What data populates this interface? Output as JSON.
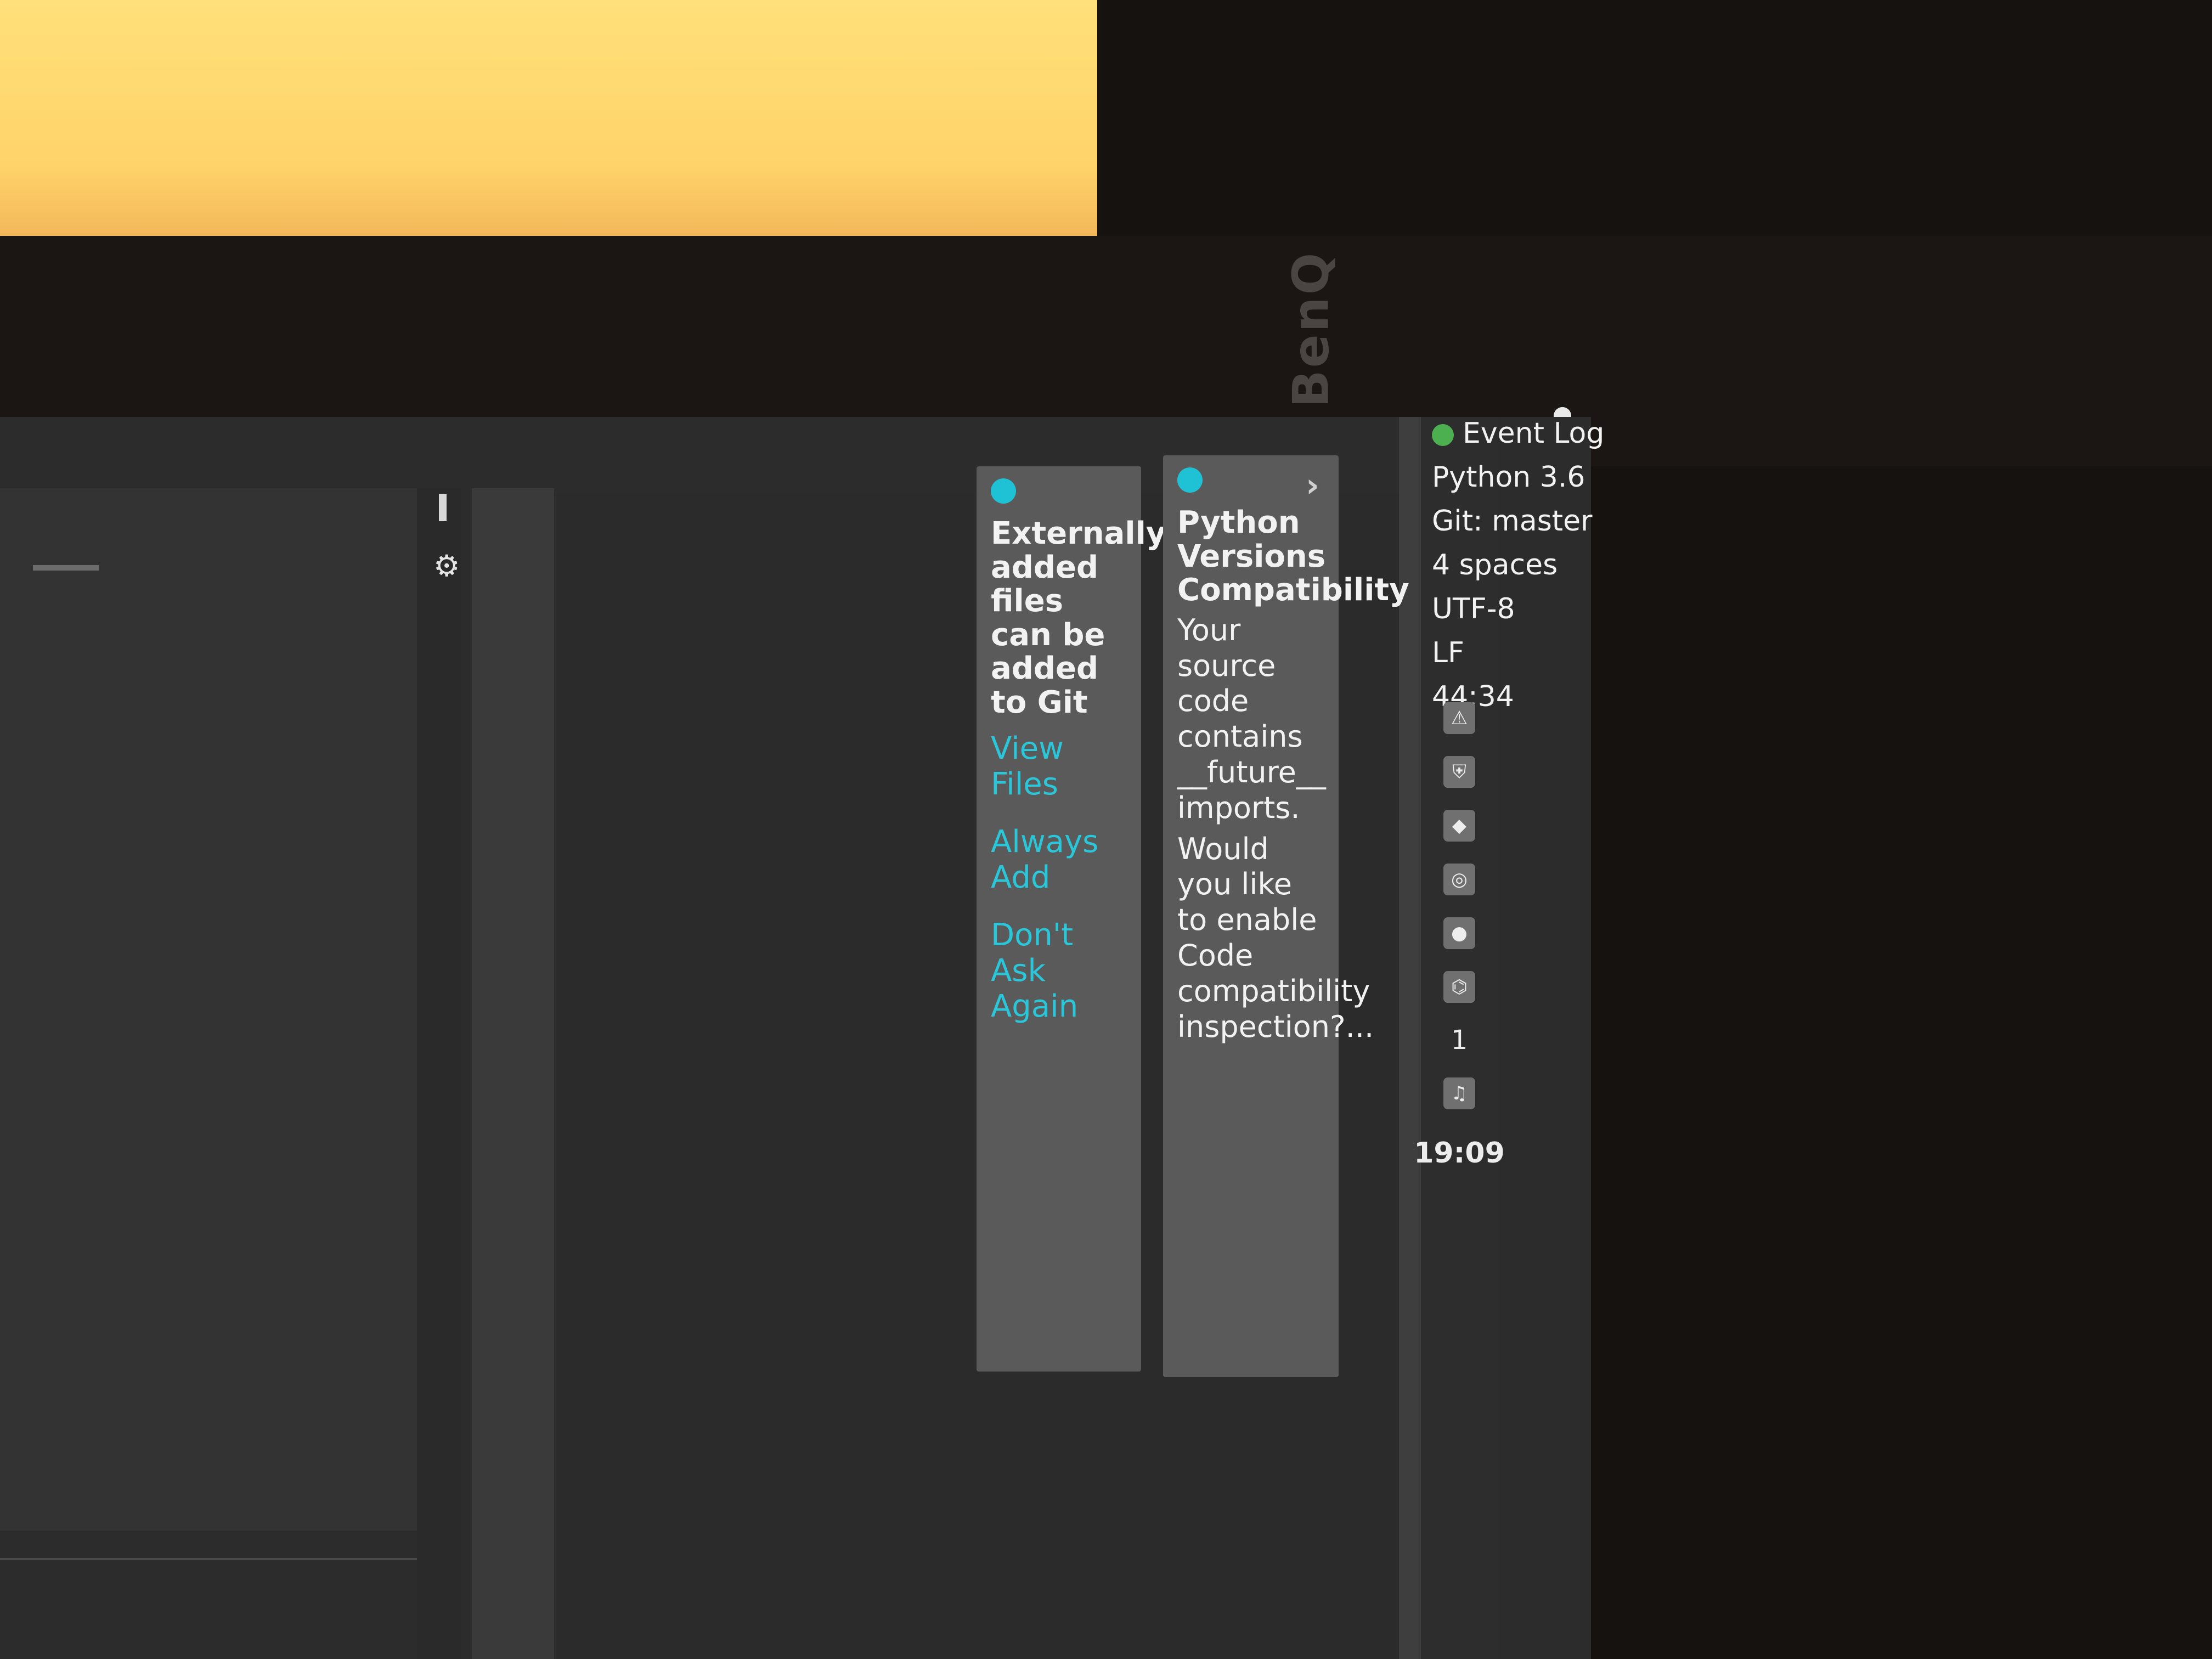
{
  "device": {
    "brand": "BenQ"
  },
  "notifications": [
    {
      "title": "Externally added files can be added to Git",
      "actions": [
        "View Files",
        "Always Add",
        "Don't Ask Again"
      ]
    },
    {
      "title": "Python Versions Compatibility",
      "body_line1": "Your source code contains __future__ imports.",
      "body_line2": "Would you like to enable Code compatibility inspection?..."
    }
  ],
  "statusbar": {
    "event_log": "Event Log",
    "python_version": "Python 3.6",
    "git_branch": "Git: master",
    "indent": "4 spaces",
    "encoding": "UTF-8",
    "line_ending": "LF",
    "cursor_position": "44:34"
  },
  "tray": {
    "icons": [
      "warning-icon",
      "shield-icon",
      "jetbrains-icon",
      "steam-icon",
      "notification-icon",
      "network-icon",
      "audio-icon"
    ],
    "network_badge": "1",
    "clock": "19:09"
  },
  "colors": {
    "accent": "#29c7d9",
    "notification_bg": "#5a5a5a",
    "ide_bg": "#2b2b2b",
    "event_dot": "#4caf50",
    "wall_light": "#ffd36a"
  }
}
